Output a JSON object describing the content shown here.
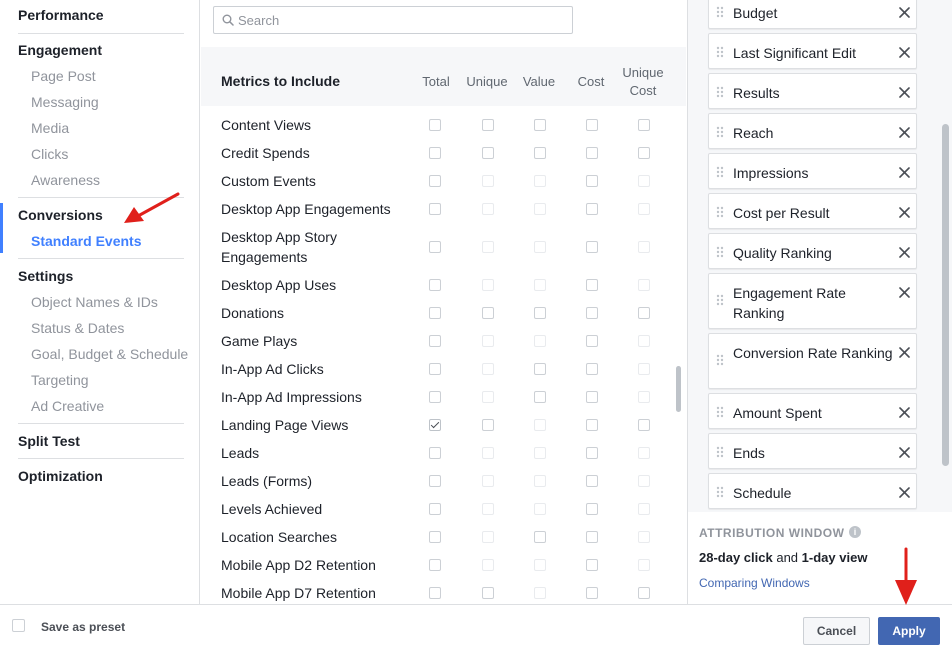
{
  "nav": {
    "sections": [
      {
        "title": "Performance",
        "items": []
      },
      {
        "title": "Engagement",
        "items": [
          "Page Post",
          "Messaging",
          "Media",
          "Clicks",
          "Awareness"
        ]
      },
      {
        "title": "Conversions",
        "items": [
          "Standard Events"
        ],
        "active_item": "Standard Events"
      },
      {
        "title": "Settings",
        "items": [
          "Object Names & IDs",
          "Status & Dates",
          "Goal, Budget & Schedule",
          "Targeting",
          "Ad Creative"
        ]
      },
      {
        "title": "Split Test",
        "items": []
      },
      {
        "title": "Optimization",
        "items": []
      }
    ]
  },
  "metrics": {
    "search_placeholder": "Search",
    "title": "Metrics to Include",
    "columns": [
      "Total",
      "Unique",
      "Value",
      "Cost",
      "Unique Cost"
    ],
    "rows": [
      {
        "label": "Content Views",
        "checked": [
          false,
          false,
          false,
          false,
          false
        ],
        "available": [
          true,
          true,
          true,
          true,
          true
        ]
      },
      {
        "label": "Credit Spends",
        "checked": [
          false,
          false,
          false,
          false,
          false
        ],
        "available": [
          true,
          true,
          true,
          true,
          true
        ]
      },
      {
        "label": "Custom Events",
        "checked": [
          false,
          false,
          false,
          false,
          false
        ],
        "available": [
          true,
          false,
          false,
          true,
          false
        ]
      },
      {
        "label": "Desktop App Engagements",
        "checked": [
          false,
          false,
          false,
          false,
          false
        ],
        "available": [
          true,
          false,
          false,
          true,
          false
        ]
      },
      {
        "label": "Desktop App Story Engagements",
        "checked": [
          false,
          false,
          false,
          false,
          false
        ],
        "available": [
          true,
          false,
          false,
          true,
          false
        ]
      },
      {
        "label": "Desktop App Uses",
        "checked": [
          false,
          false,
          false,
          false,
          false
        ],
        "available": [
          true,
          false,
          false,
          true,
          false
        ]
      },
      {
        "label": "Donations",
        "checked": [
          false,
          false,
          false,
          false,
          false
        ],
        "available": [
          true,
          true,
          true,
          true,
          true
        ]
      },
      {
        "label": "Game Plays",
        "checked": [
          false,
          false,
          false,
          false,
          false
        ],
        "available": [
          true,
          false,
          false,
          true,
          false
        ]
      },
      {
        "label": "In-App Ad Clicks",
        "checked": [
          false,
          false,
          false,
          false,
          false
        ],
        "available": [
          true,
          false,
          true,
          true,
          false
        ]
      },
      {
        "label": "In-App Ad Impressions",
        "checked": [
          false,
          false,
          false,
          false,
          false
        ],
        "available": [
          true,
          false,
          true,
          true,
          false
        ]
      },
      {
        "label": "Landing Page Views",
        "checked": [
          true,
          false,
          false,
          false,
          false
        ],
        "available": [
          true,
          true,
          false,
          true,
          true
        ]
      },
      {
        "label": "Leads",
        "checked": [
          false,
          false,
          false,
          false,
          false
        ],
        "available": [
          true,
          false,
          false,
          true,
          false
        ]
      },
      {
        "label": "Leads (Forms)",
        "checked": [
          false,
          false,
          false,
          false,
          false
        ],
        "available": [
          true,
          false,
          false,
          true,
          false
        ]
      },
      {
        "label": "Levels Achieved",
        "checked": [
          false,
          false,
          false,
          false,
          false
        ],
        "available": [
          true,
          false,
          false,
          true,
          false
        ]
      },
      {
        "label": "Location Searches",
        "checked": [
          false,
          false,
          false,
          false,
          false
        ],
        "available": [
          true,
          false,
          true,
          true,
          false
        ]
      },
      {
        "label": "Mobile App D2 Retention",
        "checked": [
          false,
          false,
          false,
          false,
          false
        ],
        "available": [
          true,
          false,
          false,
          true,
          false
        ]
      },
      {
        "label": "Mobile App D7 Retention",
        "checked": [
          false,
          false,
          false,
          false,
          false
        ],
        "available": [
          true,
          true,
          false,
          true,
          true
        ]
      }
    ]
  },
  "selected_columns": {
    "items": [
      "Budget",
      "Last Significant Edit",
      "Results",
      "Reach",
      "Impressions",
      "Cost per Result",
      "Quality Ranking",
      "Engagement Rate Ranking",
      "Conversion Rate Ranking",
      "Amount Spent",
      "Ends",
      "Schedule"
    ]
  },
  "attribution": {
    "title": "ATTRIBUTION WINDOW",
    "info_icon": "info-icon",
    "click_window": "28-day click",
    "joiner": "and",
    "view_window": "1-day view",
    "link": "Comparing Windows"
  },
  "footer": {
    "preset_label": "Save as preset",
    "cancel_label": "Cancel",
    "apply_label": "Apply"
  },
  "colors": {
    "accent": "#4267b2",
    "active_nav": "#4080ff",
    "annotation_arrow": "#e0201b"
  }
}
